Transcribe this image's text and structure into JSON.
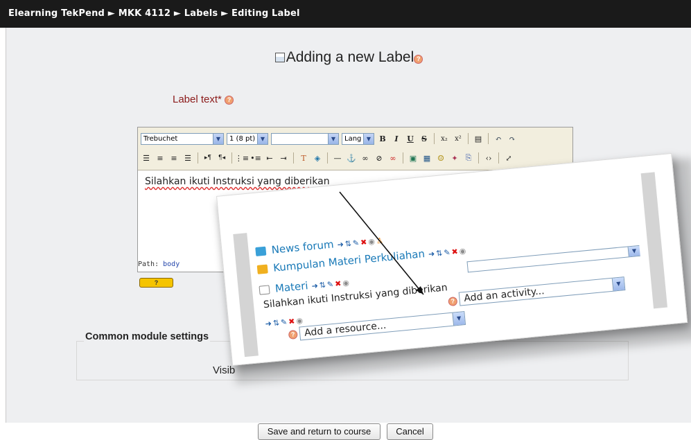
{
  "breadcrumb": {
    "site": "Elearning TekPend",
    "course": "MKK 4112",
    "module": "Labels",
    "page": "Editing Label",
    "separator": "►"
  },
  "page_title": "Adding a new Label",
  "label_text_field": {
    "label": "Label text*"
  },
  "editor": {
    "font_family": "Trebuchet",
    "font_size": "1 (8 pt)",
    "format": "",
    "lang": "Lang",
    "toolbar_row1": [
      "bold-icon",
      "italic-icon",
      "underline-icon",
      "strikethrough-icon",
      "subscript-icon",
      "superscript-icon",
      "clean-word-icon",
      "undo-icon",
      "redo-icon"
    ],
    "toolbar_row2": [
      "align-left-icon",
      "align-center-icon",
      "align-right-icon",
      "justify-icon",
      "ltr-icon",
      "rtl-icon",
      "ordered-list-icon",
      "unordered-list-icon",
      "outdent-icon",
      "indent-icon",
      "text-color-icon",
      "bg-color-icon",
      "horizontal-rule-icon",
      "anchor-icon",
      "link-icon",
      "unlink-icon",
      "nolink-icon",
      "image-icon",
      "table-icon",
      "smiley-icon",
      "special-char-icon",
      "search-replace-icon",
      "html-source-icon",
      "fullscreen-icon"
    ],
    "content": "Silahkan ikuti Instruksi yang diberikan",
    "path_label": "Path:",
    "path_value": "body"
  },
  "common_module_settings": {
    "legend": "Common module settings",
    "visible_label": "Visib"
  },
  "buttons": {
    "save": "Save and return to course",
    "cancel": "Cancel"
  },
  "inset": {
    "items": [
      {
        "label": "News forum",
        "icon": "forum-icon"
      },
      {
        "label": "Kumpulan Materi Perkuliahan",
        "icon": "folder-icon"
      },
      {
        "label": "Materi",
        "icon": "resource-icon"
      }
    ],
    "label_text": "Silahkan ikuti Instruksi yang diberikan",
    "add_resource": "Add a resource...",
    "add_activity": "Add an activity..."
  },
  "colors": {
    "navbar_bg": "#1a1a1a",
    "page_bg": "#eeeff1",
    "required_label": "#8b1a1a",
    "link": "#1a7ab8"
  }
}
